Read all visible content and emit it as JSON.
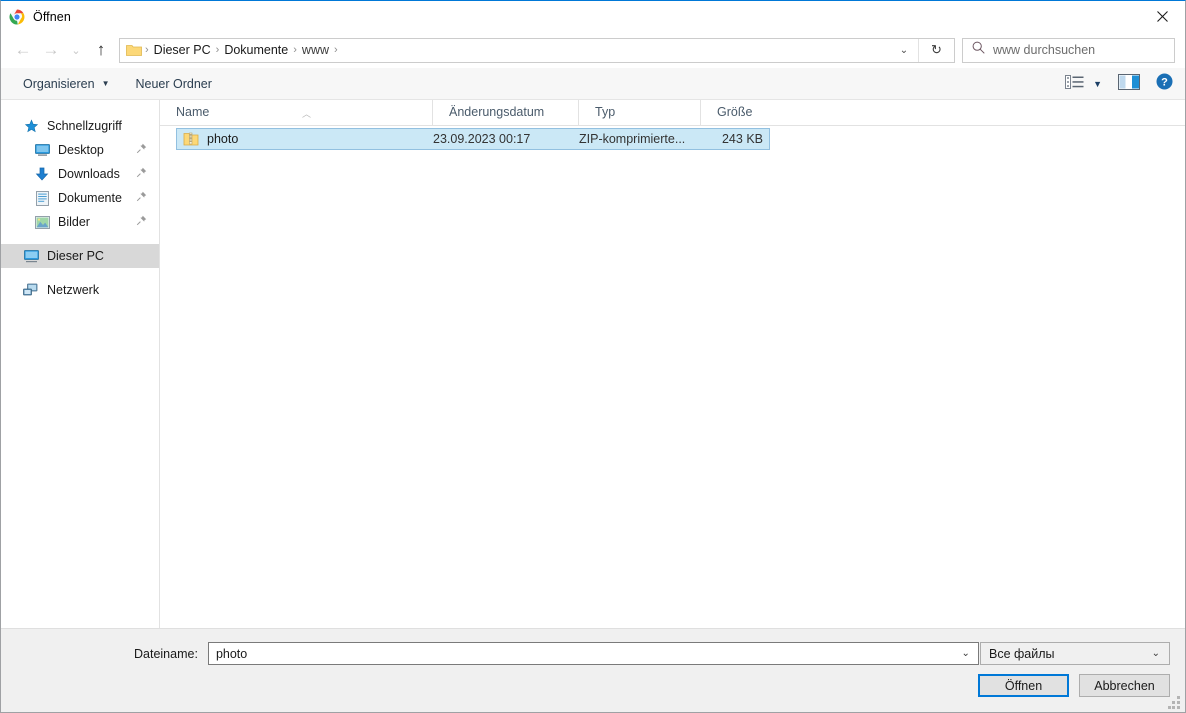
{
  "window": {
    "title": "Öffnen",
    "app_icon": "chrome-icon",
    "close_label": "✕"
  },
  "nav": {
    "back": "←",
    "forward": "→",
    "recent": "⌄",
    "up": "↑",
    "dropdown": "⌄",
    "refresh": "↻"
  },
  "address": {
    "folder_icon": "folder-icon",
    "separator": "›",
    "crumbs": [
      "Dieser PC",
      "Dokumente",
      "www"
    ]
  },
  "search": {
    "icon": "search-icon",
    "placeholder": "www durchsuchen"
  },
  "command_bar": {
    "organize_label": "Organisieren",
    "organize_caret": "▼",
    "new_folder_label": "Neuer Ordner",
    "view_icon": "view-list-icon",
    "view_caret": "▼",
    "preview_pane_icon": "preview-pane-icon",
    "help_icon": "help-icon",
    "help_glyph": "?"
  },
  "sidebar": {
    "items": [
      {
        "label": "Schnellzugriff",
        "icon": "star-icon",
        "indent": false,
        "pinned": false,
        "selected": false
      },
      {
        "label": "Desktop",
        "icon": "desktop-icon",
        "indent": true,
        "pinned": true,
        "selected": false
      },
      {
        "label": "Downloads",
        "icon": "download-icon",
        "indent": true,
        "pinned": true,
        "selected": false
      },
      {
        "label": "Dokumente",
        "icon": "documents-icon",
        "indent": true,
        "pinned": true,
        "selected": false
      },
      {
        "label": "Bilder",
        "icon": "pictures-icon",
        "indent": true,
        "pinned": true,
        "selected": false
      },
      {
        "label": "Dieser PC",
        "icon": "this-pc-icon",
        "indent": false,
        "pinned": false,
        "selected": true
      },
      {
        "label": "Netzwerk",
        "icon": "network-icon",
        "indent": false,
        "pinned": false,
        "selected": false
      }
    ],
    "pin_glyph": "📌"
  },
  "file_list": {
    "columns": [
      {
        "label": "Name",
        "key": "name"
      },
      {
        "label": "Änderungsdatum",
        "key": "date"
      },
      {
        "label": "Typ",
        "key": "type"
      },
      {
        "label": "Größe",
        "key": "size"
      }
    ],
    "sort_caret": "︿",
    "rows": [
      {
        "name": "photo",
        "date": "23.09.2023 00:17",
        "type": "ZIP-komprimierte...",
        "size": "243 KB",
        "icon": "zip-file-icon",
        "selected": true
      }
    ]
  },
  "footer": {
    "filename_label": "Dateiname:",
    "filename_value": "photo",
    "filename_caret": "⌄",
    "filter_value": "Все файлы",
    "filter_caret": "⌄",
    "open_button": "Öffnen",
    "cancel_button": "Abbrechen"
  },
  "colors": {
    "accent": "#0078d7",
    "selection_row": "#cbe8f6",
    "selection_sidebar": "#d8d8d8",
    "toolbar_bg": "#f7f7f7",
    "footer_bg": "#f0f0f0"
  }
}
